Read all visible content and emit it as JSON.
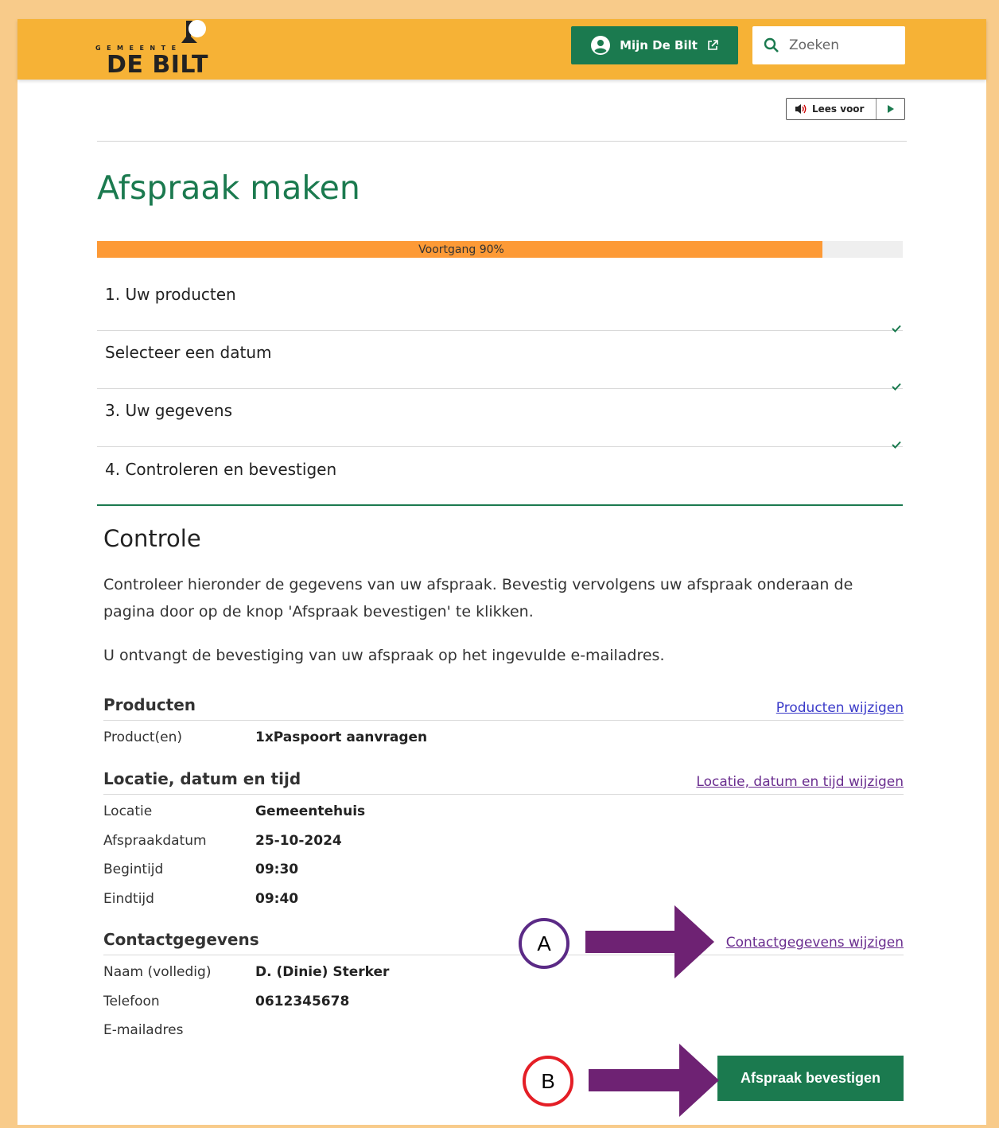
{
  "header": {
    "logo_small": "GEMEENTE",
    "logo_big": "DE BILT",
    "account_button": "Mijn De Bilt",
    "search_placeholder": "Zoeken"
  },
  "read_aloud": {
    "label": "Lees voor"
  },
  "page_title": "Afspraak maken",
  "progress": {
    "label": "Voortgang 90%",
    "percent": 90
  },
  "steps": [
    {
      "label": "1. Uw producten",
      "done": true
    },
    {
      "label": "Selecteer een datum",
      "done": true
    },
    {
      "label": "3. Uw gegevens",
      "done": true
    },
    {
      "label": "4. Controleren en bevestigen",
      "done": false
    }
  ],
  "review": {
    "title": "Controle",
    "intro": "Controleer hieronder de gegevens van uw afspraak. Bevestig vervolgens uw afspraak onderaan de pagina door op de knop 'Afspraak bevestigen' te klikken.",
    "note": "U ontvangt de bevestiging van uw afspraak op het ingevulde e-mailadres.",
    "products": {
      "title": "Producten",
      "edit_link": "Producten wijzigen",
      "rows": [
        {
          "key": "Product(en)",
          "value": "1xPaspoort aanvragen"
        }
      ]
    },
    "location": {
      "title": "Locatie, datum en tijd",
      "edit_link": "Locatie, datum en tijd wijzigen",
      "rows": [
        {
          "key": "Locatie",
          "value": "Gemeentehuis"
        },
        {
          "key": "Afspraakdatum",
          "value": "25-10-2024"
        },
        {
          "key": "Begintijd",
          "value": "09:30"
        },
        {
          "key": "Eindtijd",
          "value": "09:40"
        }
      ]
    },
    "contact": {
      "title": "Contactgegevens",
      "edit_link": "Contactgegevens wijzigen",
      "rows": [
        {
          "key": "Naam (volledig)",
          "value": "D. (Dinie) Sterker"
        },
        {
          "key": "Telefoon",
          "value": "0612345678"
        },
        {
          "key": "E-mailadres",
          "value": ""
        }
      ]
    },
    "confirm_button": "Afspraak bevestigen"
  },
  "annotations": {
    "a": {
      "label": "A",
      "ring_color": "#5b2a86"
    },
    "b": {
      "label": "B",
      "ring_color": "#e41e26"
    },
    "arrow_color": "#6e2273"
  },
  "colors": {
    "brand_green": "#1b7a4f",
    "header_orange": "#f6b236",
    "progress_orange": "#fd9a36"
  }
}
